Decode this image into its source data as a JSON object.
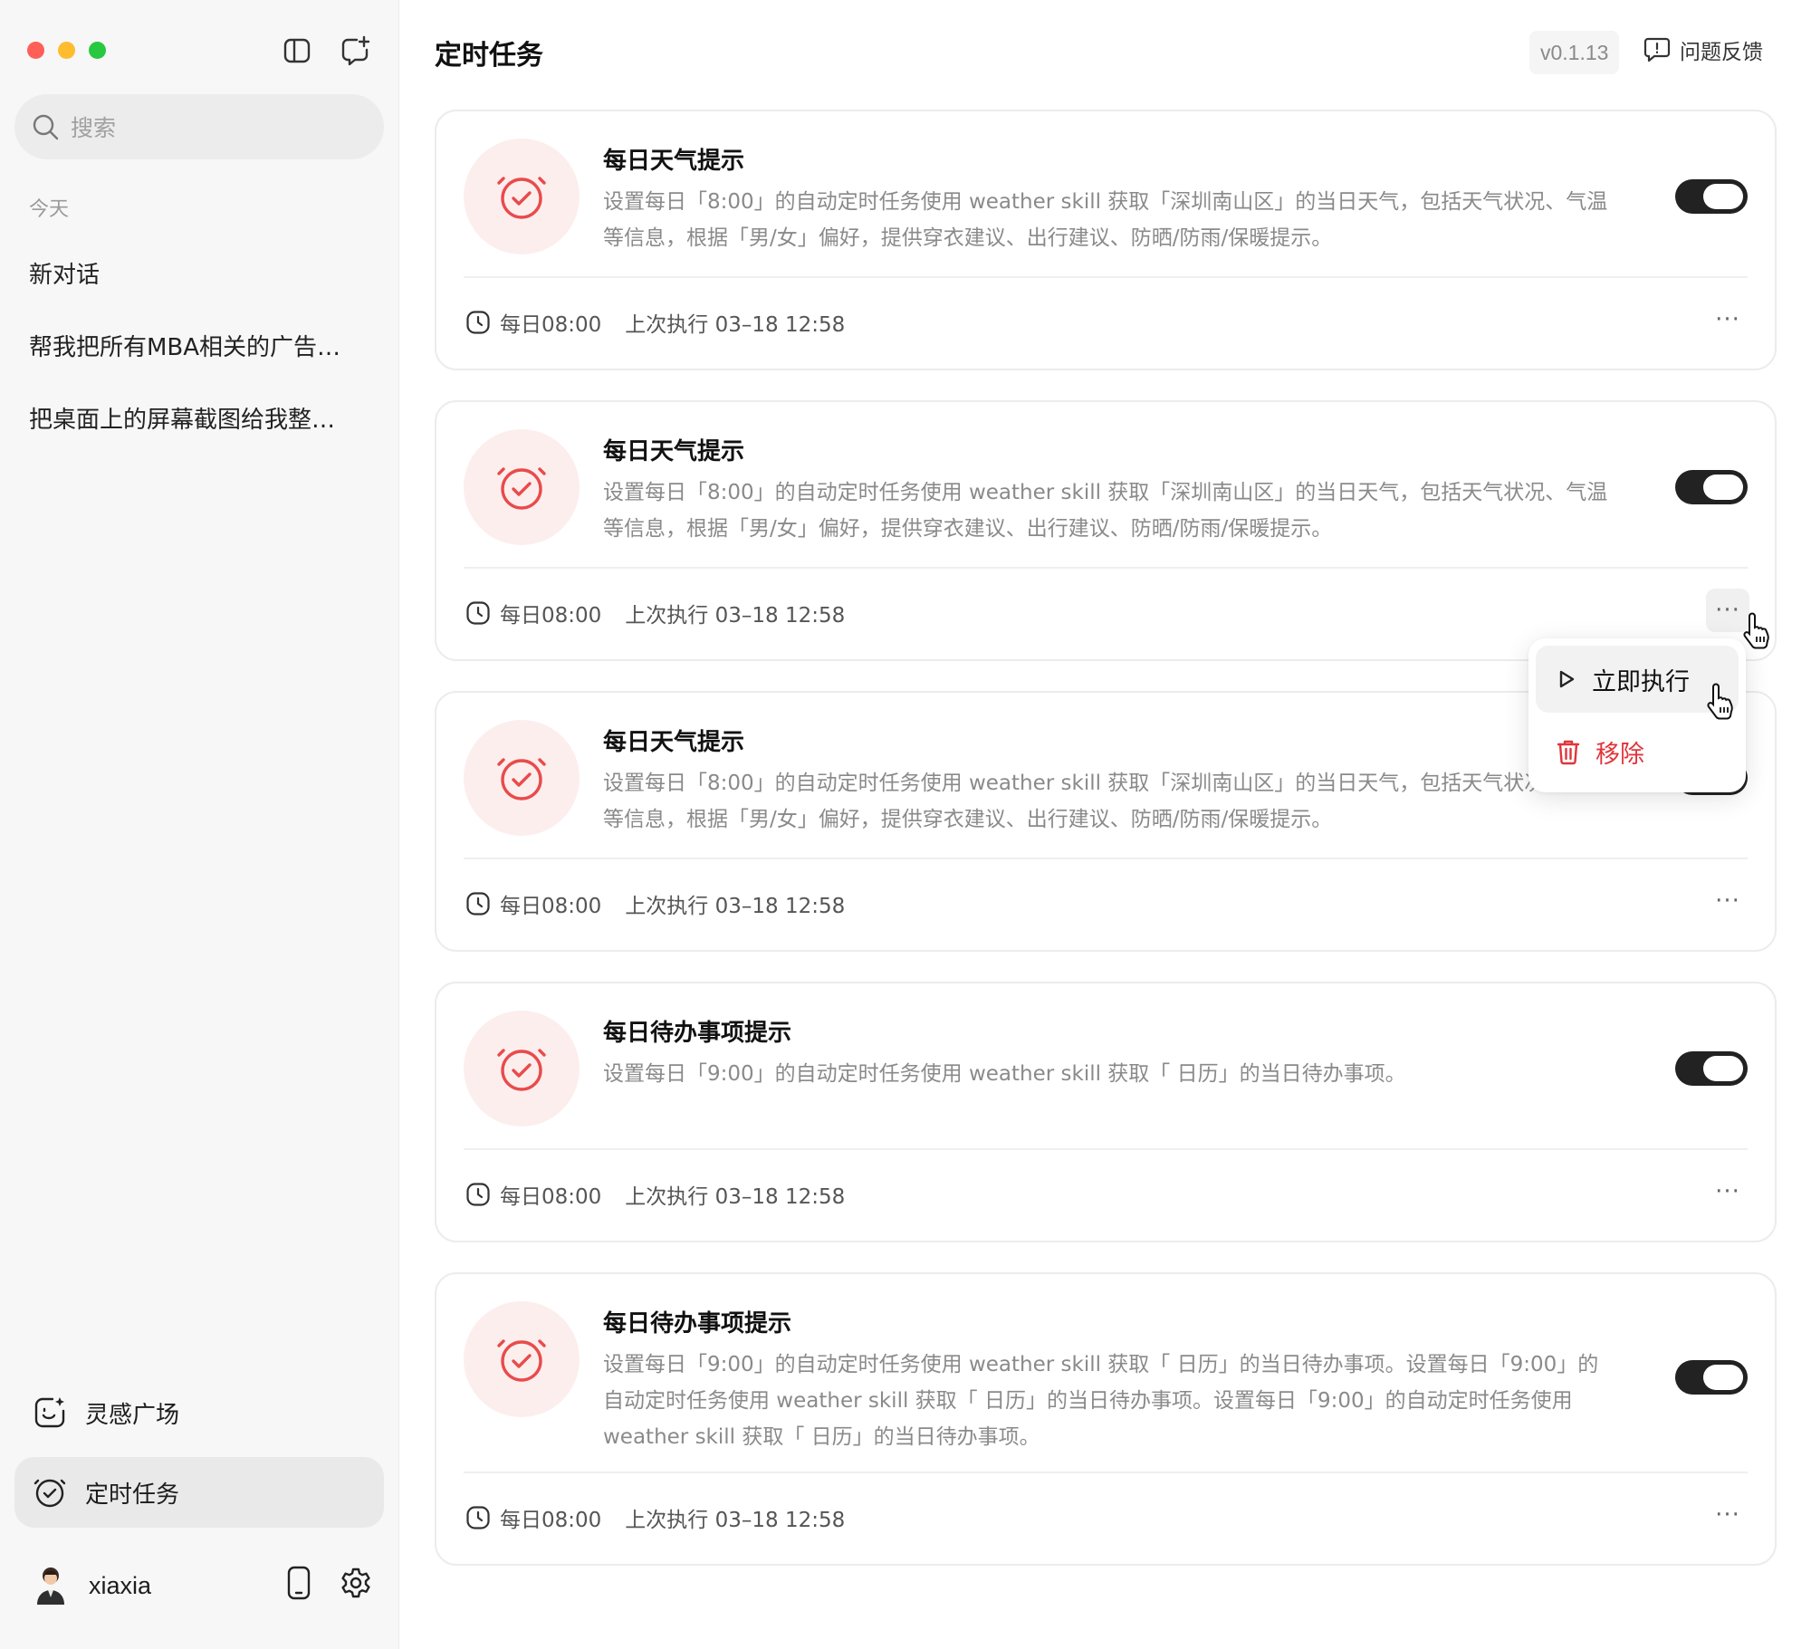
{
  "sidebar": {
    "search_placeholder": "搜索",
    "section_today": "今天",
    "conversations": [
      "新对话",
      "帮我把所有MBA相关的广告…",
      "把桌面上的屏幕截图给我整…"
    ],
    "nav": [
      {
        "label": "灵感广场",
        "icon": "sparkle-face-icon",
        "active": false
      },
      {
        "label": "定时任务",
        "icon": "alarm-clock-icon",
        "active": true
      }
    ],
    "user": {
      "name": "xiaxia"
    }
  },
  "header": {
    "title": "定时任务",
    "version": "v0.1.13",
    "feedback_label": "问题反馈"
  },
  "tasks": [
    {
      "title": "每日天气提示",
      "description": "设置每日「8:00」的自动定时任务使用 weather skill 获取「深圳南山区」的当日天气，包括天气状况、气温等信息，根据「男/女」偏好，提供穿衣建议、出行建议、防晒/防雨/保暖提示。",
      "schedule": "每日08:00",
      "last_run": "上次执行 03–18 12:58",
      "enabled": true
    },
    {
      "title": "每日天气提示",
      "description": "设置每日「8:00」的自动定时任务使用 weather skill 获取「深圳南山区」的当日天气，包括天气状况、气温等信息，根据「男/女」偏好，提供穿衣建议、出行建议、防晒/防雨/保暖提示。",
      "schedule": "每日08:00",
      "last_run": "上次执行 03–18 12:58",
      "enabled": true
    },
    {
      "title": "每日天气提示",
      "description": "设置每日「8:00」的自动定时任务使用 weather skill 获取「深圳南山区」的当日天气，包括天气状况、气温等信息，根据「男/女」偏好，提供穿衣建议、出行建议、防晒/防雨/保暖提示。",
      "schedule": "每日08:00",
      "last_run": "上次执行 03–18 12:58",
      "enabled": true
    },
    {
      "title": "每日待办事项提示",
      "description": "设置每日「9:00」的自动定时任务使用 weather skill 获取「 日历」的当日待办事项。",
      "schedule": "每日08:00",
      "last_run": "上次执行 03–18 12:58",
      "enabled": true
    },
    {
      "title": "每日待办事项提示",
      "description": "设置每日「9:00」的自动定时任务使用 weather skill 获取「 日历」的当日待办事项。设置每日「9:00」的自动定时任务使用 weather skill 获取「 日历」的当日待办事项。设置每日「9:00」的自动定时任务使用 weather skill 获取「 日历」的当日待办事项。",
      "schedule": "每日08:00",
      "last_run": "上次执行 03–18 12:58",
      "enabled": true
    }
  ],
  "context_menu": {
    "run_now": "立即执行",
    "remove": "移除"
  },
  "colors": {
    "accent_red": "#e94b4b",
    "icon_bg": "#fdeeee",
    "danger": "#e0353b",
    "toggle_on": "#222222"
  }
}
